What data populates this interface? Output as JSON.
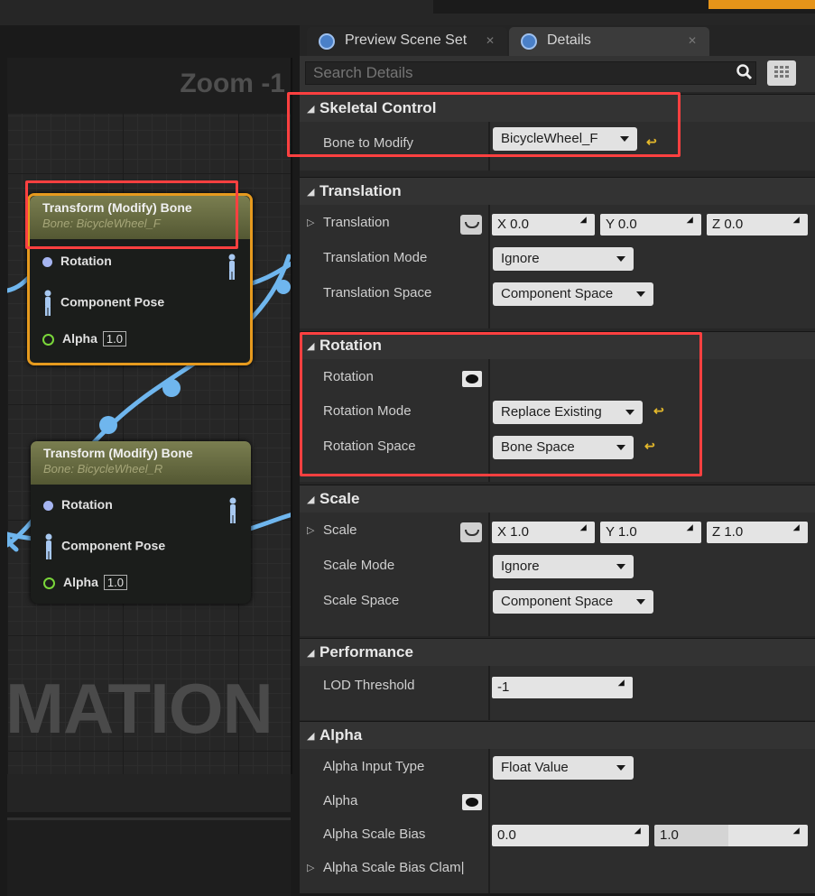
{
  "tabs": {
    "preview": "Preview Scene Set",
    "details": "Details"
  },
  "search": {
    "placeholder": "Search Details"
  },
  "graph": {
    "zoom": "Zoom -1",
    "watermark": "MATION",
    "nodes": [
      {
        "title": "Transform (Modify) Bone",
        "subtitle": "Bone: BicycleWheel_F",
        "pins": {
          "rotation": "Rotation",
          "pose": "Component Pose",
          "alpha": "Alpha",
          "alpha_value": "1.0"
        }
      },
      {
        "title": "Transform (Modify) Bone",
        "subtitle": "Bone: BicycleWheel_R",
        "pins": {
          "rotation": "Rotation",
          "pose": "Component Pose",
          "alpha": "Alpha",
          "alpha_value": "1.0"
        }
      }
    ]
  },
  "details": {
    "skeletal_control": {
      "header": "Skeletal Control",
      "bone_to_modify": {
        "label": "Bone to Modify",
        "value": "BicycleWheel_F"
      }
    },
    "translation": {
      "header": "Translation",
      "translation": {
        "label": "Translation",
        "x": "X  0.0",
        "y": "Y  0.0",
        "z": "Z  0.0"
      },
      "mode": {
        "label": "Translation Mode",
        "value": "Ignore"
      },
      "space": {
        "label": "Translation Space",
        "value": "Component Space"
      }
    },
    "rotation": {
      "header": "Rotation",
      "rotation_label": "Rotation",
      "mode": {
        "label": "Rotation Mode",
        "value": "Replace Existing"
      },
      "space": {
        "label": "Rotation Space",
        "value": "Bone Space"
      }
    },
    "scale": {
      "header": "Scale",
      "scale": {
        "label": "Scale",
        "x": "X  1.0",
        "y": "Y  1.0",
        "z": "Z  1.0"
      },
      "mode": {
        "label": "Scale Mode",
        "value": "Ignore"
      },
      "space": {
        "label": "Scale Space",
        "value": "Component Space"
      }
    },
    "performance": {
      "header": "Performance",
      "lod": {
        "label": "LOD Threshold",
        "value": "-1"
      }
    },
    "alpha": {
      "header": "Alpha",
      "input_type": {
        "label": "Alpha Input Type",
        "value": "Float Value"
      },
      "alpha_label": "Alpha",
      "scale_bias": {
        "label": "Alpha Scale Bias",
        "min": "0.0",
        "max": "1.0"
      },
      "scale_bias_clamp": {
        "label": "Alpha Scale Bias Clam|"
      }
    }
  },
  "colors": {
    "highlight": "#ff4040",
    "reset_arrow": "#e5b92b",
    "wire": "#6fb6ee",
    "node_selected": "#e69a1e"
  }
}
